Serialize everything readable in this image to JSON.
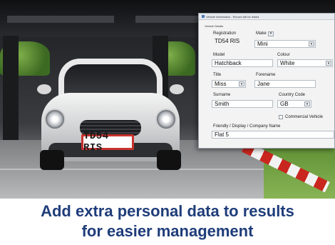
{
  "window": {
    "title": "Vehicle Information - Record will be linked",
    "group_label": "Vehicle Details",
    "registration_label": "Registration",
    "registration_value": "TD54 RIS",
    "make_label": "Make",
    "make_value": "Mini",
    "model_label": "Model",
    "model_value": "Hatchback",
    "colour_label": "Colour",
    "colour_value": "White",
    "title_label": "Title",
    "title_value": "Miss",
    "forename_label": "Forename",
    "forename_value": "Jane",
    "surname_label": "Surname",
    "surname_value": "Smith",
    "country_code_label": "Country Code",
    "country_code_value": "GB",
    "commercial_vehicle_label": "Commercial Vehicle",
    "commercial_vehicle_checked": false,
    "friendly_name_label": "Friendly / Display / Company Name",
    "friendly_name_value": "Flat 5"
  },
  "photo": {
    "plate_text": "TD54 RIS"
  },
  "caption": {
    "line1": "Add extra personal data to results",
    "line2": "for easier management"
  },
  "colors": {
    "caption_text": "#1f3d7a",
    "plate_border": "#c7332e"
  }
}
